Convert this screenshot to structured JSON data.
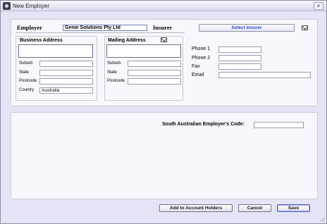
{
  "window": {
    "title": "New Employer",
    "close_label": "×"
  },
  "employer": {
    "label": "Employer",
    "name_value": "Genie Solutions Pty Ltd",
    "insurer_label": "Insurer",
    "select_insurer_label": "Select Insurer"
  },
  "business_address": {
    "title": "Business Address",
    "suburb_label": "Suburb",
    "suburb_value": "",
    "state_label": "State",
    "state_value": "",
    "postcode_label": "Postcode",
    "postcode_value": "",
    "country_label": "Country",
    "country_value": "Australia"
  },
  "mailing_address": {
    "title": "Mailing Address",
    "suburb_label": "Suburb",
    "suburb_value": "",
    "state_label": "State",
    "state_value": "",
    "postcode_label": "Postcode",
    "postcode_value": ""
  },
  "contact": {
    "phone1_label": "Phone 1",
    "phone1_value": "",
    "phone2_label": "Phone 2",
    "phone2_value": "",
    "fax_label": "Fax",
    "fax_value": "",
    "email_label": "Email",
    "email_value": ""
  },
  "sa_code": {
    "label": "South Australian Employer's Code:",
    "value": ""
  },
  "buttons": {
    "add_to_account_holders": "Add to Account Holders",
    "cancel": "Cancel",
    "save": "Save"
  },
  "icons": {
    "app": "app-icon",
    "insurer_mail": "envelope-icon",
    "mailing_copy": "envelope-icon",
    "resize": "resize-grip-icon"
  }
}
